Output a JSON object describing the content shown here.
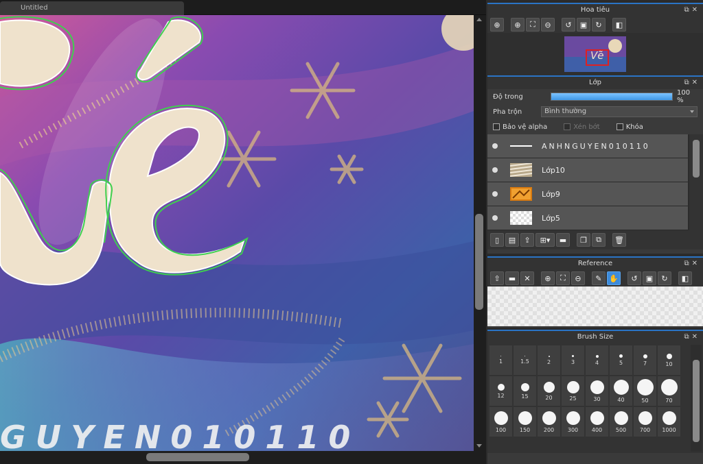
{
  "document": {
    "tab_title": "Untitled"
  },
  "canvas": {
    "bottom_text": "GUYEN010110",
    "big_text": "Vẽ"
  },
  "navigator": {
    "title": "Hoa tiêu",
    "thumb_text": "Vẽ",
    "tools": [
      "zoom-fit-icon",
      "zoom-in-icon",
      "fit-screen-icon",
      "zoom-out-icon",
      "rotate-left-icon",
      "actual-size-icon",
      "rotate-right-icon",
      "flip-icon"
    ]
  },
  "layers": {
    "title": "Lớp",
    "opacity_label": "Độ trong",
    "opacity_value": "100 %",
    "opacity_percent": 100,
    "blend_label": "Pha trộn",
    "blend_value": "Bình thường",
    "protect_alpha": "Bảo vệ alpha",
    "clipping": "Xén bớt",
    "lock": "Khóa",
    "items": [
      {
        "name": "ANHNGUYEN010110",
        "thumb": "line"
      },
      {
        "name": "Lớp10",
        "thumb": "stripes"
      },
      {
        "name": "Lớp9",
        "thumb": "orange"
      },
      {
        "name": "Lớp5",
        "thumb": "transparent"
      }
    ]
  },
  "reference": {
    "title": "Reference"
  },
  "brush_size": {
    "title": "Brush Size",
    "sizes": [
      "1",
      "1.5",
      "2",
      "3",
      "4",
      "5",
      "7",
      "10",
      "12",
      "15",
      "20",
      "25",
      "30",
      "40",
      "50",
      "70",
      "100",
      "150",
      "200",
      "300",
      "400",
      "500",
      "700",
      "1000"
    ]
  },
  "colors": {
    "accent": "#2a74c6",
    "active_tool": "#3c8bdc",
    "selection_frame": "#e02020"
  }
}
